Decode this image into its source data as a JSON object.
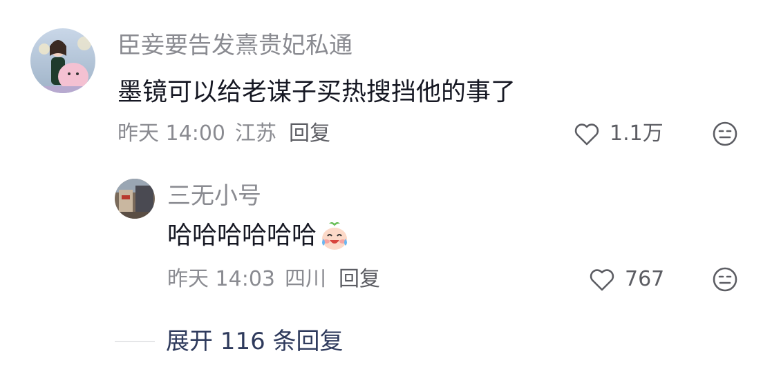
{
  "comment": {
    "username": "臣妾要告发熹贵妃私通",
    "content": "墨镜可以给老谋子买热搜挡他的事了",
    "time": "昨天 14:00",
    "location": "江苏",
    "reply_label": "回复",
    "likes": "1.1万",
    "avatar_icon": "user-avatar-girl",
    "like_icon": "heart-outline-icon",
    "dislike_icon": "meh-face-icon"
  },
  "reply": {
    "username": "三无小号",
    "content": "哈哈哈哈哈哈",
    "emoji": "crying-laughing-emoji",
    "time": "昨天 14:03",
    "location": "四川",
    "reply_label": "回复",
    "likes": "767",
    "avatar_icon": "user-avatar-building"
  },
  "expand": {
    "label": "展开 116 条回复"
  },
  "colors": {
    "primary_text": "#161823",
    "secondary_text": "#8a8b91",
    "link": "#2e3a5c",
    "divider": "#e5e6e8"
  }
}
